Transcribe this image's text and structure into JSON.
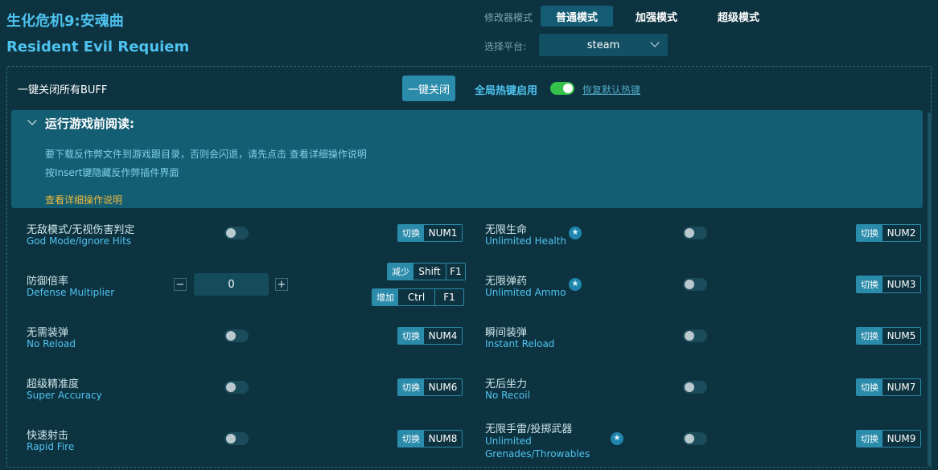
{
  "header": {
    "title_cn": "生化危机9:安魂曲",
    "title_en": "Resident Evil Requiem",
    "mode_label": "修改器模式",
    "modes": [
      {
        "label": "普通模式",
        "active": true
      },
      {
        "label": "加强模式",
        "active": false
      },
      {
        "label": "超级模式",
        "active": false
      }
    ],
    "platform_label": "选择平台:",
    "platform_value": "steam"
  },
  "toolbar": {
    "buff_label": "一键关闭所有BUFF",
    "onekey_button": "一键关闭",
    "global_hotkey_label": "全局热键启用",
    "global_hotkey_enabled": true,
    "restore_link": "恢复默认热键"
  },
  "notice": {
    "title": "运行游戏前阅读:",
    "line1": "要下载反作弊文件到游戏跟目录，否则会闪退，请先点击 查看详细操作说明",
    "line2": "按Insert键隐藏反作弊插件界面",
    "link": "查看详细操作说明"
  },
  "cheats": {
    "god_mode": {
      "cn": "无敌模式/无视伤害判定",
      "en": "God Mode/Ignore Hits",
      "action": "切换",
      "key": "NUM1",
      "enabled": false
    },
    "defense": {
      "cn": "防御倍率",
      "en": "Defense Multiplier",
      "value": "0",
      "minus": "−",
      "plus": "+",
      "dec_action": "减少",
      "dec_keys": [
        "Shift",
        "F1"
      ],
      "inc_action": "增加",
      "inc_keys": [
        "Ctrl",
        "F1"
      ]
    },
    "no_reload": {
      "cn": "无需装弹",
      "en": "No Reload",
      "action": "切换",
      "key": "NUM4",
      "enabled": false
    },
    "super_accuracy": {
      "cn": "超级精准度",
      "en": "Super Accuracy",
      "action": "切换",
      "key": "NUM6",
      "enabled": false
    },
    "rapid_fire": {
      "cn": "快速射击",
      "en": "Rapid Fire",
      "action": "切换",
      "key": "NUM8",
      "enabled": false
    },
    "unlimited_health": {
      "cn": "无限生命",
      "en": "Unlimited Health",
      "action": "切换",
      "key": "NUM2",
      "enabled": false,
      "starred": true
    },
    "unlimited_ammo": {
      "cn": "无限弹药",
      "en": "Unlimited Ammo",
      "action": "切换",
      "key": "NUM3",
      "enabled": false,
      "starred": true
    },
    "instant_reload": {
      "cn": "瞬间装弹",
      "en": "Instant Reload",
      "action": "切换",
      "key": "NUM5",
      "enabled": false
    },
    "no_recoil": {
      "cn": "无后坐力",
      "en": "No Recoil",
      "action": "切换",
      "key": "NUM7",
      "enabled": false
    },
    "unlimited_grenades": {
      "cn": "无限手雷/投掷武器",
      "en": "Unlimited Grenades/Throwables",
      "action": "切换",
      "key": "NUM9",
      "enabled": false,
      "starred": true
    }
  },
  "icons": {
    "star": "star-icon",
    "chevron": "chevron-down-icon"
  },
  "colors": {
    "background": "#0d3340",
    "accent": "#4fc3f0",
    "button": "#2b8bab",
    "toggle_on": "#35c04a",
    "link_gold": "#f0b93a"
  }
}
